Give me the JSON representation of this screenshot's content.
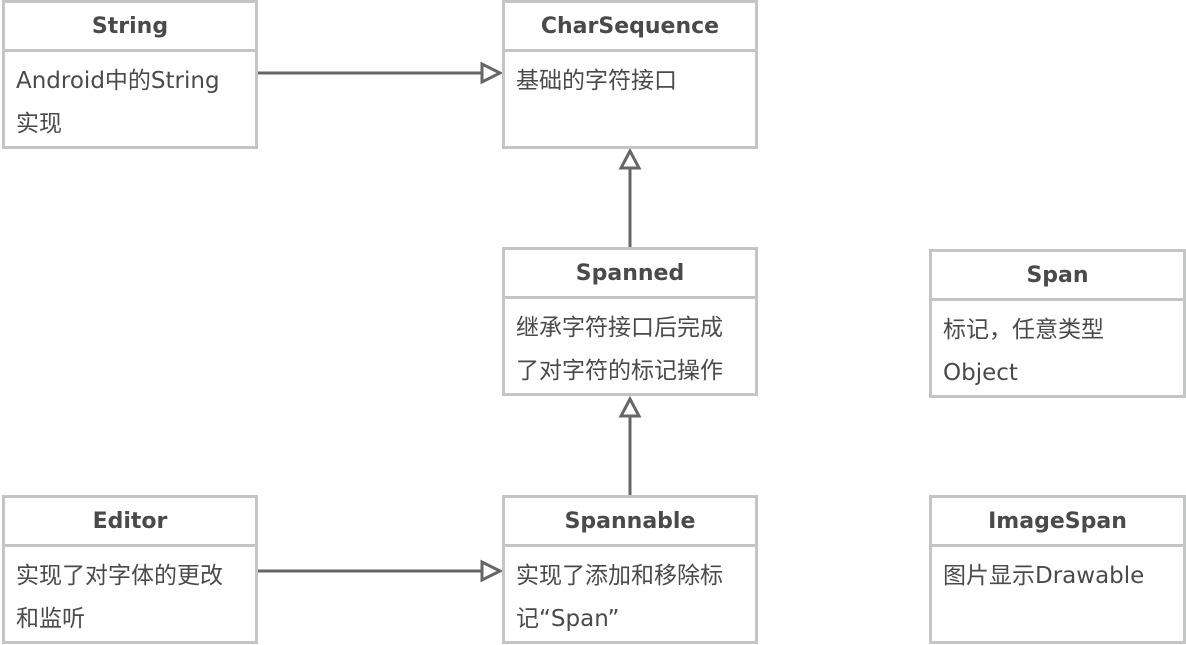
{
  "boxes": {
    "string": {
      "title": "String",
      "line1": "Android中的String",
      "line2": "实现"
    },
    "charseq": {
      "title": "CharSequence",
      "line1": "基础的字符接口",
      "line2": ""
    },
    "spanned": {
      "title": "Spanned",
      "line1": "继承字符接口后完成",
      "line2": "了对字符的标记操作"
    },
    "span": {
      "title": "Span",
      "line1": "标记，任意类型",
      "line2": "Object"
    },
    "editor": {
      "title": "Editor",
      "line1": "实现了对字体的更改",
      "line2": "和监听"
    },
    "spannable": {
      "title": "Spannable",
      "line1": "实现了添加和移除标",
      "line2": "记“Span”"
    },
    "imagespan": {
      "title": "ImageSpan",
      "line1": "图片显示Drawable",
      "line2": ""
    }
  },
  "relations": [
    {
      "from": "String",
      "to": "CharSequence",
      "type": "realization"
    },
    {
      "from": "Spanned",
      "to": "CharSequence",
      "type": "generalization"
    },
    {
      "from": "Spannable",
      "to": "Spanned",
      "type": "generalization"
    },
    {
      "from": "Editor",
      "to": "Spannable",
      "type": "realization"
    }
  ],
  "colors": {
    "border": "#c4c6c6",
    "text": "#4a4a4a",
    "edge": "#666666"
  }
}
